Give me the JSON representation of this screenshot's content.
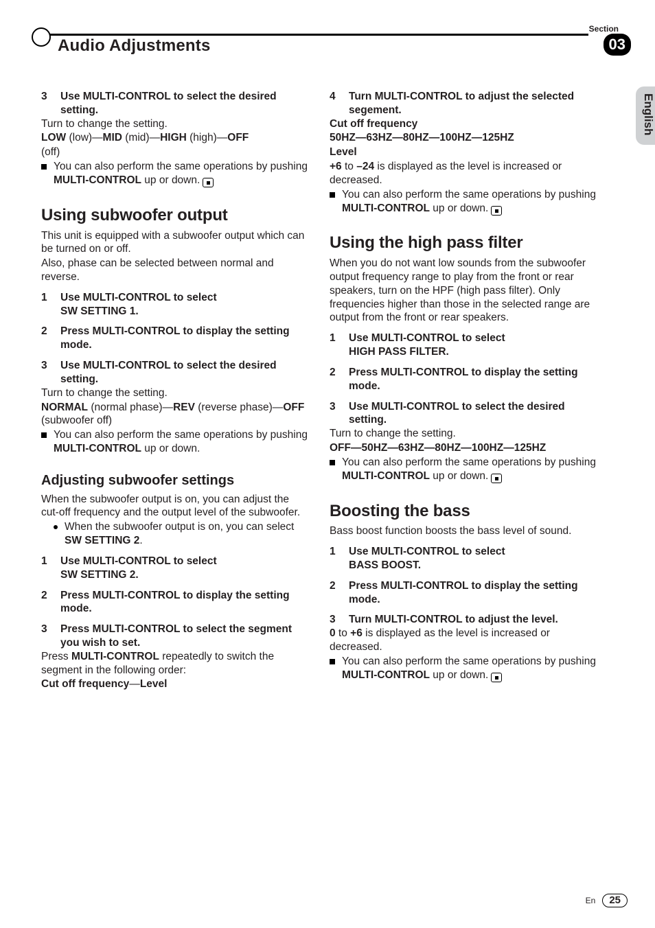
{
  "header": {
    "section_label": "Section",
    "section_number": "03",
    "title": "Audio Adjustments"
  },
  "side_tab": {
    "language": "English"
  },
  "footer": {
    "lang_code": "En",
    "page": "25"
  },
  "c1": {
    "s3": {
      "n": "3",
      "title": "Use MULTI-CONTROL to select the de­sired setting.",
      "turn": "Turn to change the setting.",
      "opt_low_b": "LOW",
      "opt_low_p": " (low)—",
      "opt_mid_b": "MID",
      "opt_mid_p": " (mid)—",
      "opt_high_b": "HIGH",
      "opt_high_p": " (high)—",
      "opt_off_b": "OFF",
      "opt_off_p": "(off)",
      "note1": "You can also perform the same operations by pushing ",
      "note_ctrl": "MULTI-CONTROL",
      "note2": " up or down."
    },
    "sw": {
      "h1": "Using subwoofer output",
      "intro1": "This unit is equipped with a subwoofer output which can be turned on or off.",
      "intro2": "Also, phase can be selected between normal and reverse.",
      "s1": {
        "n": "1",
        "t_a": "Use MULTI-CONTROL to select",
        "t_b": "SW SETTING 1."
      },
      "s2": {
        "n": "2",
        "t": "Press MULTI-CONTROL to display the setting mode."
      },
      "s3": {
        "n": "3",
        "t": "Use MULTI-CONTROL to select the de­sired setting.",
        "turn": "Turn to change the setting.",
        "opt_n_b": "NORMAL",
        "opt_n_p": " (normal phase)—",
        "opt_r_b": "REV",
        "opt_r_p": " (reverse phase)—",
        "opt_o_b": "OFF",
        "opt_o_p": " (subwoofer off)",
        "note1": "You can also perform the same operations by pushing ",
        "note_ctrl": "MULTI-CONTROL",
        "note2": " up or down."
      },
      "adj": {
        "h2": "Adjusting subwoofer settings",
        "intro": "When the subwoofer output is on, you can ad­just the cut-off frequency and the output level of the subwoofer.",
        "b_a": "When the subwoofer output is on, you can select ",
        "b_b": "SW SETTING 2",
        "b_c": ".",
        "s1": {
          "n": "1",
          "t_a": "Use MULTI-CONTROL to select",
          "t_b": "SW SETTING 2."
        },
        "s2": {
          "n": "2",
          "t": "Press MULTI-CONTROL to display the setting mode."
        },
        "s3": {
          "n": "3",
          "t": "Press MULTI-CONTROL to select the seg­ment you wish to set.",
          "l1a": "Press ",
          "l1b": "MULTI-CONTROL",
          "l1c": " repeatedly to switch the segment in the following order:",
          "opts_a": "Cut off frequency",
          "opts_sep": "—",
          "opts_b": "Level"
        }
      }
    }
  },
  "c2": {
    "s4": {
      "n": "4",
      "t": "Turn MULTI-CONTROL to adjust the se­lected segement.",
      "cof_label": "Cut off frequency",
      "cof_opts": "50HZ—63HZ—80HZ—100HZ—125HZ",
      "lvl_label": "Level",
      "lvl_a": "+6",
      "lvl_to": " to ",
      "lvl_b": "–24",
      "lvl_rest": " is displayed as the level is increased or decreased.",
      "note1": "You can also perform the same operations by pushing ",
      "note_ctrl": "MULTI-CONTROL",
      "note2": " up or down."
    },
    "hpf": {
      "h1": "Using the high pass filter",
      "intro": "When you do not want low sounds from the subwoofer output frequency range to play from the front or rear speakers, turn on the HPF (high pass filter). Only frequencies higher than those in the selected range are output from the front or rear speakers.",
      "s1": {
        "n": "1",
        "t_a": "Use MULTI-CONTROL to select",
        "t_b": "HIGH PASS FILTER."
      },
      "s2": {
        "n": "2",
        "t": "Press MULTI-CONTROL to display the setting mode."
      },
      "s3": {
        "n": "3",
        "t": "Use MULTI-CONTROL to select the de­sired setting.",
        "turn": "Turn to change the setting.",
        "opts": "OFF—50HZ—63HZ—80HZ—100HZ—125HZ",
        "note1": "You can also perform the same operations by pushing ",
        "note_ctrl": "MULTI-CONTROL",
        "note2": " up or down."
      }
    },
    "bb": {
      "h1": "Boosting the bass",
      "intro": "Bass boost function boosts the bass level of sound.",
      "s1": {
        "n": "1",
        "t_a": "Use MULTI-CONTROL to select",
        "t_b": "BASS BOOST."
      },
      "s2": {
        "n": "2",
        "t": "Press MULTI-CONTROL to display the setting mode."
      },
      "s3": {
        "n": "3",
        "t": "Turn MULTI-CONTROL to adjust the level.",
        "lvl_a": "0",
        "lvl_to": " to ",
        "lvl_b": "+6",
        "lvl_rest": " is displayed as the level is increased or decreased.",
        "note1": "You can also perform the same operations by pushing ",
        "note_ctrl": "MULTI-CONTROL",
        "note2": " up or down."
      }
    }
  }
}
